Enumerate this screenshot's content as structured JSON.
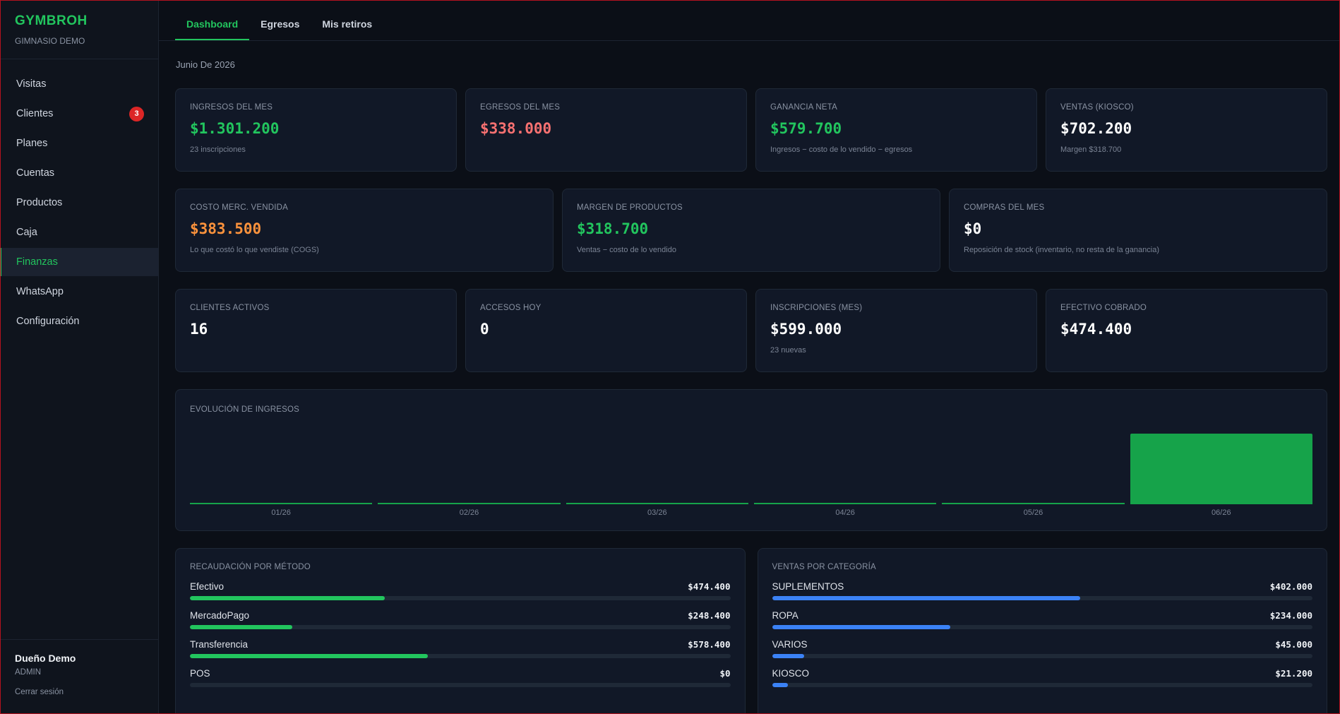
{
  "brand": {
    "name": "GYMBROH",
    "subtitle": "GIMNASIO DEMO"
  },
  "sidebar": {
    "items": [
      {
        "label": "Visitas",
        "active": false
      },
      {
        "label": "Clientes",
        "active": false,
        "badge": "3"
      },
      {
        "label": "Planes",
        "active": false
      },
      {
        "label": "Cuentas",
        "active": false
      },
      {
        "label": "Productos",
        "active": false
      },
      {
        "label": "Caja",
        "active": false
      },
      {
        "label": "Finanzas",
        "active": true
      },
      {
        "label": "WhatsApp",
        "active": false
      },
      {
        "label": "Configuración",
        "active": false
      }
    ]
  },
  "user": {
    "name": "Dueño Demo",
    "role": "ADMIN",
    "logout": "Cerrar sesión"
  },
  "tabs": [
    {
      "label": "Dashboard",
      "active": true
    },
    {
      "label": "Egresos",
      "active": false
    },
    {
      "label": "Mis retiros",
      "active": false
    }
  ],
  "period": "Junio De 2026",
  "kpis_row1": [
    {
      "label": "INGRESOS DEL MES",
      "value": "$1.301.200",
      "sub": "23 inscripciones",
      "color": "green"
    },
    {
      "label": "EGRESOS DEL MES",
      "value": "$338.000",
      "sub": "",
      "color": "red"
    },
    {
      "label": "GANANCIA NETA",
      "value": "$579.700",
      "sub": "Ingresos − costo de lo vendido − egresos",
      "color": "green"
    },
    {
      "label": "VENTAS (KIOSCO)",
      "value": "$702.200",
      "sub": "Margen $318.700",
      "color": "white"
    }
  ],
  "kpis_row2": [
    {
      "label": "COSTO MERC. VENDIDA",
      "value": "$383.500",
      "sub": "Lo que costó lo que vendiste (COGS)",
      "color": "orange"
    },
    {
      "label": "MARGEN DE PRODUCTOS",
      "value": "$318.700",
      "sub": "Ventas − costo de lo vendido",
      "color": "green"
    },
    {
      "label": "COMPRAS DEL MES",
      "value": "$0",
      "sub": "Reposición de stock (inventario, no resta de la ganancia)",
      "color": "white"
    }
  ],
  "kpis_row3": [
    {
      "label": "CLIENTES ACTIVOS",
      "value": "16",
      "sub": "",
      "color": "white"
    },
    {
      "label": "ACCESOS HOY",
      "value": "0",
      "sub": "",
      "color": "white"
    },
    {
      "label": "INSCRIPCIONES (MES)",
      "value": "$599.000",
      "sub": "23 nuevas",
      "color": "white"
    },
    {
      "label": "EFECTIVO COBRADO",
      "value": "$474.400",
      "sub": "",
      "color": "white"
    }
  ],
  "chart_data": {
    "type": "bar",
    "title": "EVOLUCIÓN DE INGRESOS",
    "categories": [
      "01/26",
      "02/26",
      "03/26",
      "04/26",
      "05/26",
      "06/26"
    ],
    "values": [
      0,
      0,
      0,
      0,
      0,
      1301200
    ],
    "ylim": [
      0,
      1301200
    ],
    "color": "#16a34a"
  },
  "metodos": {
    "title": "RECAUDACIÓN POR MÉTODO",
    "items": [
      {
        "label": "Efectivo",
        "value": "$474.400",
        "fraction": 0.36
      },
      {
        "label": "MercadoPago",
        "value": "$248.400",
        "fraction": 0.19
      },
      {
        "label": "Transferencia",
        "value": "$578.400",
        "fraction": 0.44
      },
      {
        "label": "POS",
        "value": "$0",
        "fraction": 0.0
      }
    ]
  },
  "categorias": {
    "title": "VENTAS POR CATEGORÍA",
    "items": [
      {
        "label": "SUPLEMENTOS",
        "value": "$402.000",
        "fraction": 0.57
      },
      {
        "label": "ROPA",
        "value": "$234.000",
        "fraction": 0.33
      },
      {
        "label": "VARIOS",
        "value": "$45.000",
        "fraction": 0.06
      },
      {
        "label": "KIOSCO",
        "value": "$21.200",
        "fraction": 0.03
      }
    ]
  }
}
